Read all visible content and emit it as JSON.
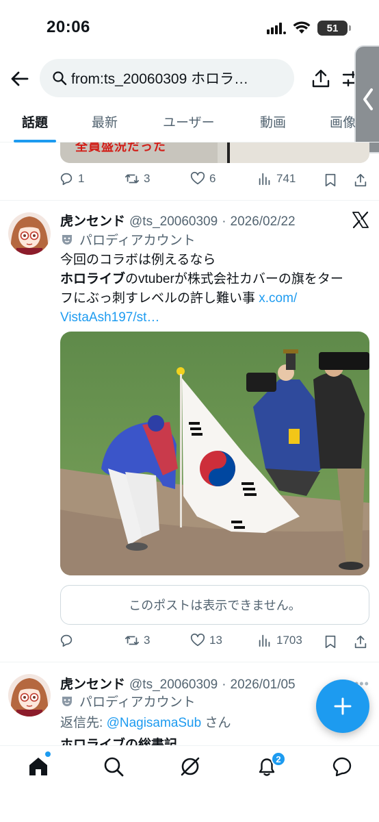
{
  "status_bar": {
    "time": "20:06",
    "battery": "51"
  },
  "search": {
    "query": "from:ts_20060309 ホロラ…"
  },
  "tabs": [
    {
      "label": "話題",
      "active": true
    },
    {
      "label": "最新",
      "active": false
    },
    {
      "label": "ユーザー",
      "active": false
    },
    {
      "label": "動画",
      "active": false
    },
    {
      "label": "画像",
      "active": false
    }
  ],
  "prev_post": {
    "image_text": "全員盛況だった",
    "actions": {
      "replies": "1",
      "reposts": "3",
      "likes": "6",
      "views": "741"
    }
  },
  "post1": {
    "display_name": "虎ンセンド",
    "handle": "@ts_20060309",
    "separator": "·",
    "date": "2026/02/22",
    "account_label": "パロディアカウント",
    "line1": "今回のコラボは例えるなら",
    "line2_bold": "ホロライブ",
    "line2_rest": "のvtuberが株式会社カバーの旗をター",
    "line3": "フにぶっ刺すレベルの許し難い事 ",
    "link_part1": "x.com/",
    "link_part2": "VistaAsh197/st…",
    "unavailable_text": "このポストは表示できません。",
    "actions": {
      "reposts": "3",
      "likes": "13",
      "views": "1703"
    }
  },
  "post2": {
    "display_name": "虎ンセンド",
    "handle": "@ts_20060309",
    "separator": "·",
    "date": "2026/01/05",
    "account_label": "パロディアカウント",
    "reply_prefix": "返信先: ",
    "reply_mention": "@NagisamaSub",
    "reply_suffix": " さん",
    "cutoff_text": "ホロライブの総書記"
  },
  "bottom_nav": {
    "notification_count": "2"
  },
  "colors": {
    "accent": "#1d9bf0",
    "text": "#0f1419",
    "muted": "#536471"
  }
}
